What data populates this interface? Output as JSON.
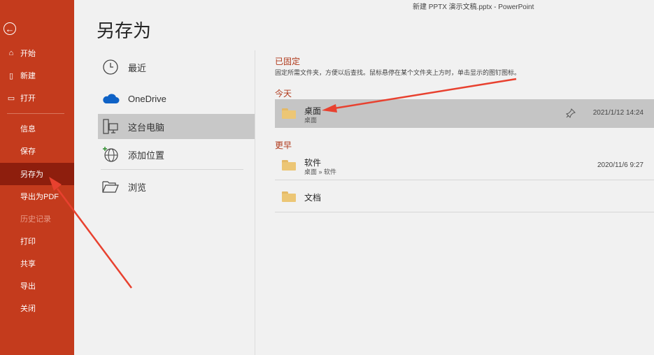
{
  "window": {
    "title": "新建 PPTX 演示文稿.pptx  -  PowerPoint"
  },
  "sidebar": {
    "top_items": [
      {
        "label": "开始",
        "icon": "home-icon"
      },
      {
        "label": "新建",
        "icon": "new-document-icon"
      },
      {
        "label": "打开",
        "icon": "open-folder-icon"
      }
    ],
    "items": [
      {
        "label": "信息"
      },
      {
        "label": "保存"
      },
      {
        "label": "另存为",
        "active": true
      },
      {
        "label": "导出为PDF"
      },
      {
        "label": "历史记录",
        "disabled": true
      },
      {
        "label": "打印"
      },
      {
        "label": "共享"
      },
      {
        "label": "导出"
      },
      {
        "label": "关闭"
      }
    ]
  },
  "page": {
    "title": "另存为"
  },
  "locations": [
    {
      "label": "最近",
      "icon": "clock-icon"
    },
    {
      "label": "OneDrive",
      "icon": "cloud-icon"
    },
    {
      "label": "这台电脑",
      "icon": "computer-icon",
      "selected": true
    },
    {
      "label": "添加位置",
      "icon": "globe-add-icon"
    },
    {
      "label": "浏览",
      "icon": "folder-open-icon"
    }
  ],
  "pinned": {
    "heading": "已固定",
    "hint": "固定所需文件夹，方便以后查找。鼠标悬停在某个文件夹上方时，单击显示的图钉图标。"
  },
  "today": {
    "heading": "今天",
    "folders": [
      {
        "name": "桌面",
        "path": "桌面",
        "date": "2021/1/12 14:24"
      }
    ]
  },
  "earlier": {
    "heading": "更早",
    "folders": [
      {
        "name": "软件",
        "path": "桌面 » 软件",
        "date": "2020/11/6 9:27"
      },
      {
        "name": "文档"
      }
    ]
  },
  "colors": {
    "sidebar": "#c43b1d",
    "sidebar_active": "#8e1e0d",
    "accent": "#b0391b",
    "annotation_arrow": "#e8412f"
  }
}
